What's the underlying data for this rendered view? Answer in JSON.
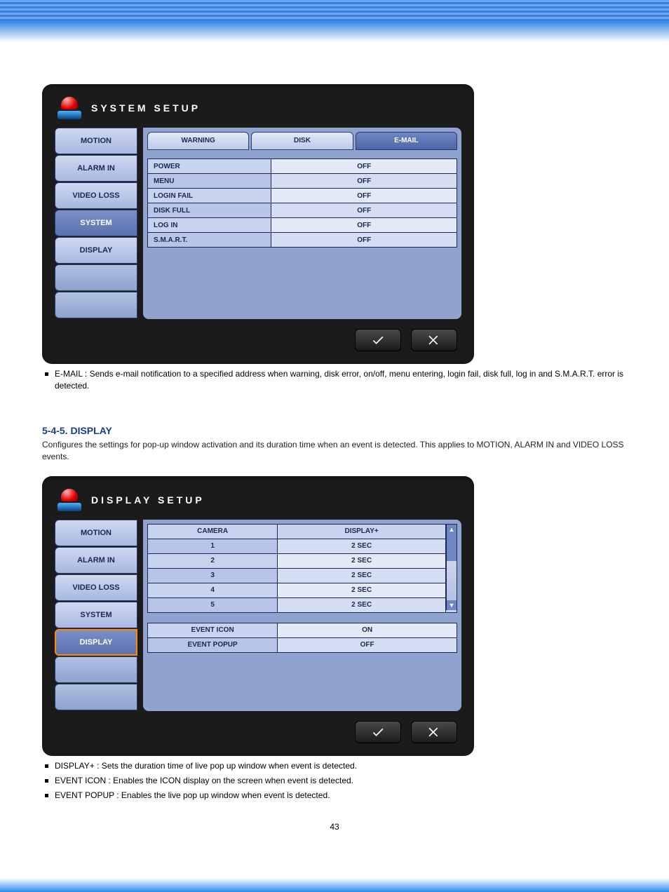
{
  "page_number": "43",
  "win1": {
    "title": "SYSTEM SETUP",
    "sidebar": [
      "MOTION",
      "ALARM IN",
      "VIDEO LOSS",
      "SYSTEM",
      "DISPLAY",
      "",
      ""
    ],
    "sidebar_selected": 3,
    "tabs": [
      "WARNING",
      "DISK",
      "E-MAIL"
    ],
    "tab_selected": 2,
    "rows": [
      {
        "label": "POWER",
        "value": "OFF"
      },
      {
        "label": "MENU",
        "value": "OFF"
      },
      {
        "label": "LOGIN FAIL",
        "value": "OFF"
      },
      {
        "label": "DISK FULL",
        "value": "OFF"
      },
      {
        "label": "LOG IN",
        "value": "OFF"
      },
      {
        "label": "S.M.A.R.T.",
        "value": "OFF"
      }
    ]
  },
  "bullet1": "E-MAIL : Sends e-mail notification to a specified address when warning, disk error, on/off, menu entering, login fail, disk full, log in and S.M.A.R.T. error is detected.",
  "section2": {
    "num": "5-4-5.",
    "title": "DISPLAY",
    "desc": "Configures the settings for pop-up window activation and its duration time when an event is detected. This applies to MOTION, ALARM IN and VIDEO LOSS events."
  },
  "win2": {
    "title": "DISPLAY SETUP",
    "sidebar": [
      "MOTION",
      "ALARM IN",
      "VIDEO LOSS",
      "SYSTEM",
      "DISPLAY",
      "",
      ""
    ],
    "sidebar_selected": 4,
    "headers": [
      "CAMERA",
      "DISPLAY+"
    ],
    "rows": [
      {
        "cam": "1",
        "val": "2 SEC"
      },
      {
        "cam": "2",
        "val": "2 SEC"
      },
      {
        "cam": "3",
        "val": "2 SEC"
      },
      {
        "cam": "4",
        "val": "2 SEC"
      },
      {
        "cam": "5",
        "val": "2 SEC"
      }
    ],
    "opts": [
      {
        "label": "EVENT ICON",
        "value": "ON"
      },
      {
        "label": "EVENT POPUP",
        "value": "OFF"
      }
    ]
  },
  "bullets2": [
    "DISPLAY+ : Sets the duration time of live pop up window when event is detected.",
    "EVENT ICON : Enables the ICON display on the screen when event is detected.",
    "EVENT POPUP : Enables the live pop up window when event is detected."
  ]
}
